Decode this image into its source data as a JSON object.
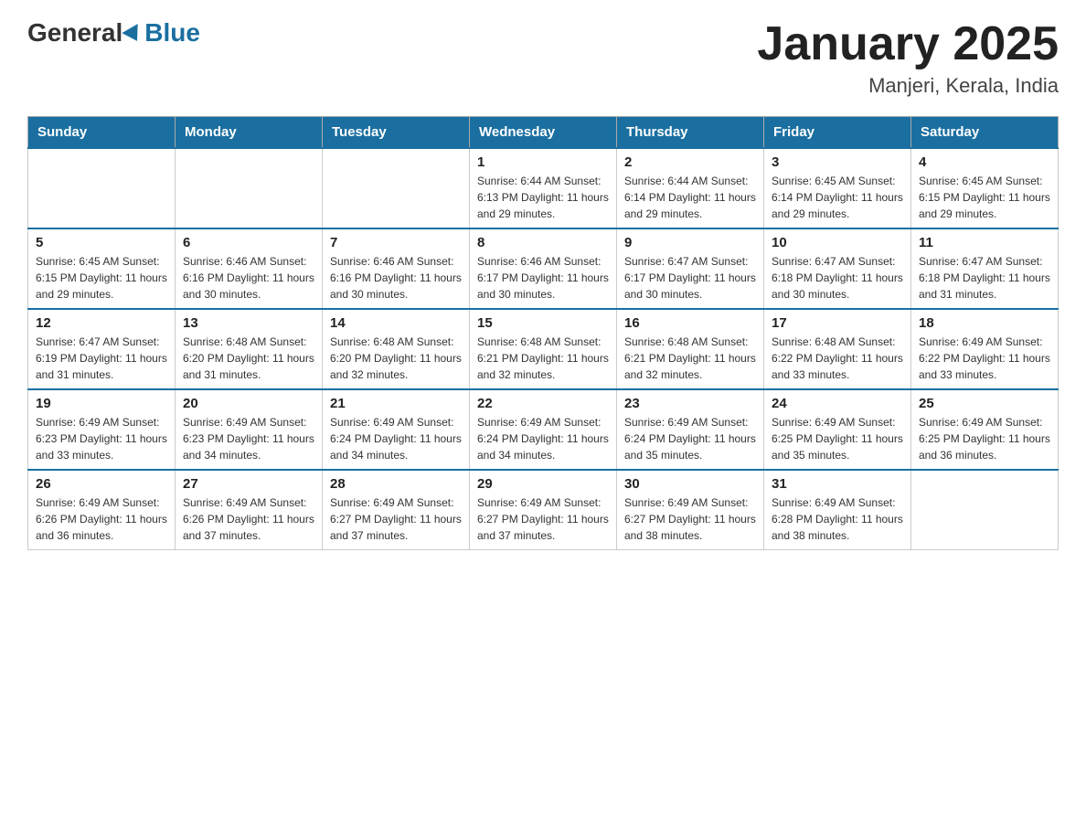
{
  "header": {
    "logo_general": "General",
    "logo_blue": "Blue",
    "month_title": "January 2025",
    "location": "Manjeri, Kerala, India"
  },
  "calendar": {
    "days_of_week": [
      "Sunday",
      "Monday",
      "Tuesday",
      "Wednesday",
      "Thursday",
      "Friday",
      "Saturday"
    ],
    "weeks": [
      [
        {
          "day": "",
          "info": ""
        },
        {
          "day": "",
          "info": ""
        },
        {
          "day": "",
          "info": ""
        },
        {
          "day": "1",
          "info": "Sunrise: 6:44 AM\nSunset: 6:13 PM\nDaylight: 11 hours and 29 minutes."
        },
        {
          "day": "2",
          "info": "Sunrise: 6:44 AM\nSunset: 6:14 PM\nDaylight: 11 hours and 29 minutes."
        },
        {
          "day": "3",
          "info": "Sunrise: 6:45 AM\nSunset: 6:14 PM\nDaylight: 11 hours and 29 minutes."
        },
        {
          "day": "4",
          "info": "Sunrise: 6:45 AM\nSunset: 6:15 PM\nDaylight: 11 hours and 29 minutes."
        }
      ],
      [
        {
          "day": "5",
          "info": "Sunrise: 6:45 AM\nSunset: 6:15 PM\nDaylight: 11 hours and 29 minutes."
        },
        {
          "day": "6",
          "info": "Sunrise: 6:46 AM\nSunset: 6:16 PM\nDaylight: 11 hours and 30 minutes."
        },
        {
          "day": "7",
          "info": "Sunrise: 6:46 AM\nSunset: 6:16 PM\nDaylight: 11 hours and 30 minutes."
        },
        {
          "day": "8",
          "info": "Sunrise: 6:46 AM\nSunset: 6:17 PM\nDaylight: 11 hours and 30 minutes."
        },
        {
          "day": "9",
          "info": "Sunrise: 6:47 AM\nSunset: 6:17 PM\nDaylight: 11 hours and 30 minutes."
        },
        {
          "day": "10",
          "info": "Sunrise: 6:47 AM\nSunset: 6:18 PM\nDaylight: 11 hours and 30 minutes."
        },
        {
          "day": "11",
          "info": "Sunrise: 6:47 AM\nSunset: 6:18 PM\nDaylight: 11 hours and 31 minutes."
        }
      ],
      [
        {
          "day": "12",
          "info": "Sunrise: 6:47 AM\nSunset: 6:19 PM\nDaylight: 11 hours and 31 minutes."
        },
        {
          "day": "13",
          "info": "Sunrise: 6:48 AM\nSunset: 6:20 PM\nDaylight: 11 hours and 31 minutes."
        },
        {
          "day": "14",
          "info": "Sunrise: 6:48 AM\nSunset: 6:20 PM\nDaylight: 11 hours and 32 minutes."
        },
        {
          "day": "15",
          "info": "Sunrise: 6:48 AM\nSunset: 6:21 PM\nDaylight: 11 hours and 32 minutes."
        },
        {
          "day": "16",
          "info": "Sunrise: 6:48 AM\nSunset: 6:21 PM\nDaylight: 11 hours and 32 minutes."
        },
        {
          "day": "17",
          "info": "Sunrise: 6:48 AM\nSunset: 6:22 PM\nDaylight: 11 hours and 33 minutes."
        },
        {
          "day": "18",
          "info": "Sunrise: 6:49 AM\nSunset: 6:22 PM\nDaylight: 11 hours and 33 minutes."
        }
      ],
      [
        {
          "day": "19",
          "info": "Sunrise: 6:49 AM\nSunset: 6:23 PM\nDaylight: 11 hours and 33 minutes."
        },
        {
          "day": "20",
          "info": "Sunrise: 6:49 AM\nSunset: 6:23 PM\nDaylight: 11 hours and 34 minutes."
        },
        {
          "day": "21",
          "info": "Sunrise: 6:49 AM\nSunset: 6:24 PM\nDaylight: 11 hours and 34 minutes."
        },
        {
          "day": "22",
          "info": "Sunrise: 6:49 AM\nSunset: 6:24 PM\nDaylight: 11 hours and 34 minutes."
        },
        {
          "day": "23",
          "info": "Sunrise: 6:49 AM\nSunset: 6:24 PM\nDaylight: 11 hours and 35 minutes."
        },
        {
          "day": "24",
          "info": "Sunrise: 6:49 AM\nSunset: 6:25 PM\nDaylight: 11 hours and 35 minutes."
        },
        {
          "day": "25",
          "info": "Sunrise: 6:49 AM\nSunset: 6:25 PM\nDaylight: 11 hours and 36 minutes."
        }
      ],
      [
        {
          "day": "26",
          "info": "Sunrise: 6:49 AM\nSunset: 6:26 PM\nDaylight: 11 hours and 36 minutes."
        },
        {
          "day": "27",
          "info": "Sunrise: 6:49 AM\nSunset: 6:26 PM\nDaylight: 11 hours and 37 minutes."
        },
        {
          "day": "28",
          "info": "Sunrise: 6:49 AM\nSunset: 6:27 PM\nDaylight: 11 hours and 37 minutes."
        },
        {
          "day": "29",
          "info": "Sunrise: 6:49 AM\nSunset: 6:27 PM\nDaylight: 11 hours and 37 minutes."
        },
        {
          "day": "30",
          "info": "Sunrise: 6:49 AM\nSunset: 6:27 PM\nDaylight: 11 hours and 38 minutes."
        },
        {
          "day": "31",
          "info": "Sunrise: 6:49 AM\nSunset: 6:28 PM\nDaylight: 11 hours and 38 minutes."
        },
        {
          "day": "",
          "info": ""
        }
      ]
    ]
  }
}
